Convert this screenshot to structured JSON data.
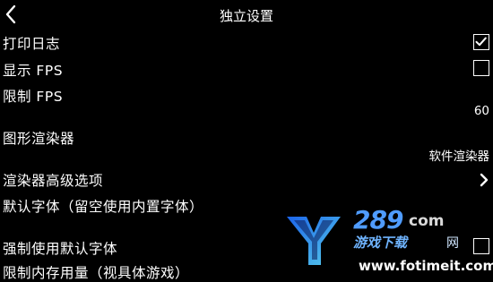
{
  "header": {
    "title": "独立设置",
    "back_icon": "chevron-left-icon"
  },
  "settings": {
    "print_log": {
      "label": "打印日志",
      "checked": true
    },
    "show_fps": {
      "label": "显示 FPS",
      "checked": false
    },
    "limit_fps": {
      "label": "限制 FPS",
      "value": "60"
    },
    "renderer": {
      "label": "图形渲染器",
      "value": "软件渲染器"
    },
    "renderer_advanced": {
      "label": "渲染器高级选项",
      "icon": "chevron-right-icon"
    },
    "default_font": {
      "label": "默认字体（留空使用内置字体）"
    },
    "force_default_font": {
      "label": "强制使用默认字体",
      "checked": false
    },
    "memory_limit": {
      "label": "限制内存用量（视具体游戏）"
    }
  },
  "watermark": {
    "logo_icon": "fotimeit-logo-icon",
    "number": "289",
    "com": "com",
    "site": "游戏下载",
    "net": "网",
    "url": "www.fotimeit.com"
  },
  "colors": {
    "background": "#000000",
    "foreground": "#ffffff",
    "watermark_accent": "#4f9cff"
  }
}
